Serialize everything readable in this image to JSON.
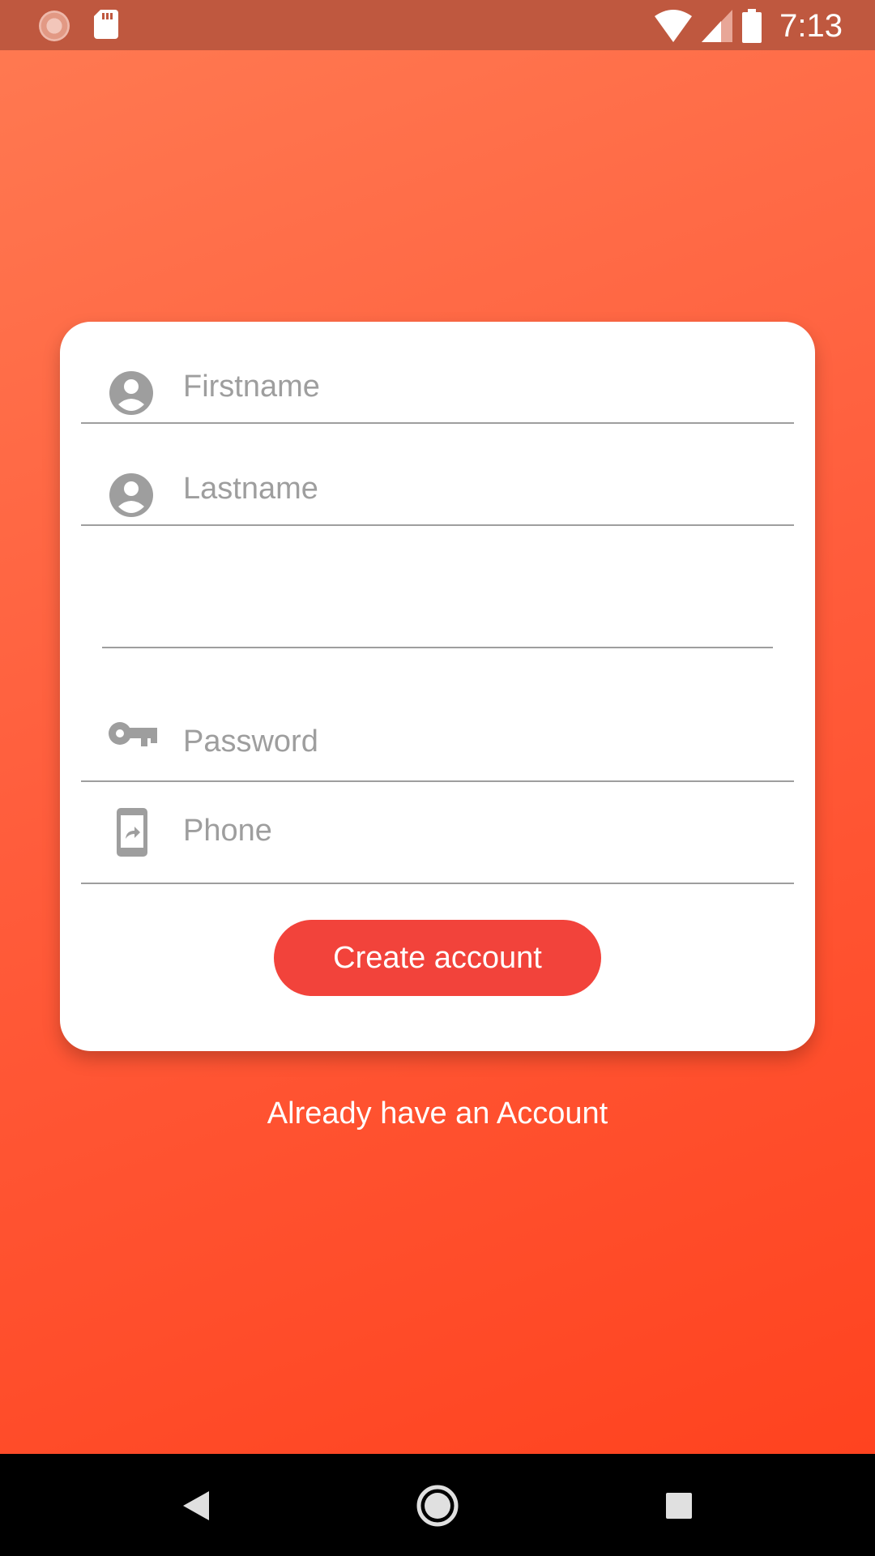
{
  "status_bar": {
    "time": "7:13",
    "icons": [
      "loading-indicator-icon",
      "sd-card-icon",
      "wifi-icon",
      "cellular-signal-icon",
      "battery-icon"
    ]
  },
  "form": {
    "firstname_placeholder": "Firstname",
    "lastname_placeholder": "Lastname",
    "email_value": "",
    "password_placeholder": "Password",
    "phone_placeholder": "Phone",
    "submit_label": "Create account"
  },
  "links": {
    "login_label": "Already have an Account"
  },
  "nav_bar": {
    "icons": [
      "back-icon",
      "home-icon",
      "recents-icon"
    ]
  },
  "colors": {
    "gradient_start": "#ff7a52",
    "gradient_end": "#ff401c",
    "status_bar": "#bf583f",
    "button": "#f2433b",
    "icon_gray": "#9e9e9e"
  }
}
